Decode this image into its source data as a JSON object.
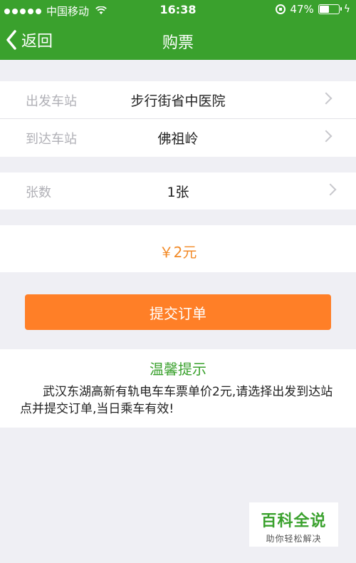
{
  "status_bar": {
    "carrier": "中国移动",
    "time": "16:38",
    "battery": "47%",
    "battery_level": 0.47
  },
  "nav": {
    "back_label": "返回",
    "title": "购票"
  },
  "form": {
    "departure_label": "出发车站",
    "departure_value": "步行街省中医院",
    "arrival_label": "到达车站",
    "arrival_value": "佛祖岭",
    "quantity_label": "张数",
    "quantity_value": "1张"
  },
  "price": "￥2元",
  "submit_label": "提交订单",
  "tip": {
    "title": "温馨提示",
    "text": "武汉东湖高新有轨电车车票单价2元,请选择出发到达站点并提交订单,当日乘车有效!"
  },
  "watermark": {
    "title": "百科全说",
    "subtitle": "助你轻松解决"
  },
  "colors": {
    "brand_green": "#3aa12d",
    "accent_orange": "#ff7f27",
    "price_orange": "#f28a27"
  },
  "icons": [
    "signal-dots-icon",
    "wifi-icon",
    "rotation-lock-icon",
    "battery-icon",
    "charging-icon",
    "back-chevron-icon",
    "chevron-right-icon"
  ]
}
